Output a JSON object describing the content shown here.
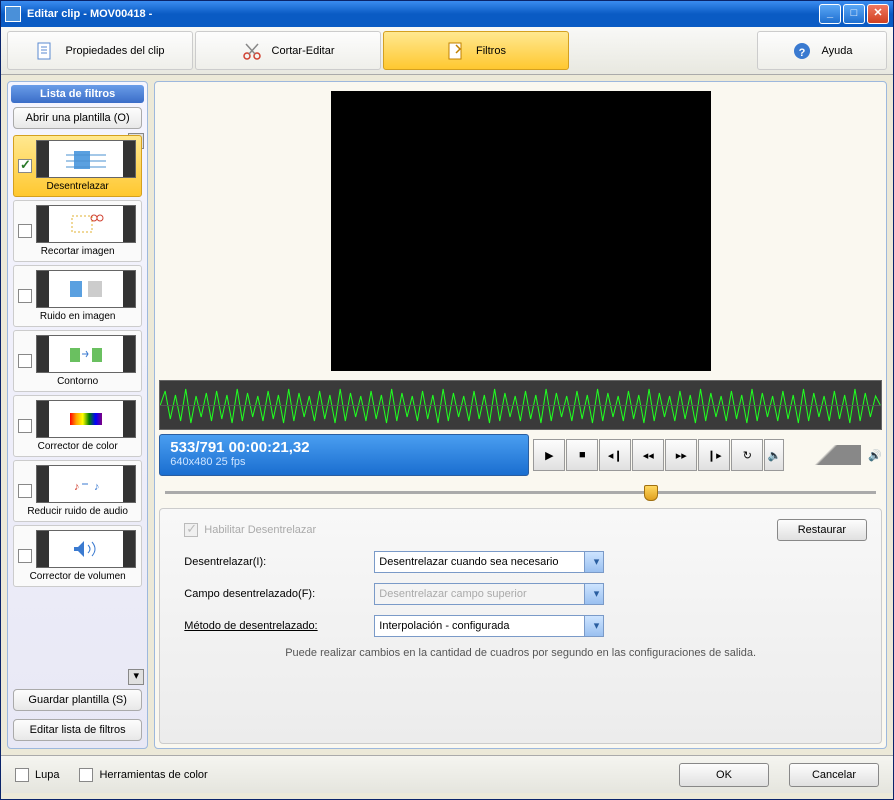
{
  "title": "Editar clip - MOV00418 -",
  "toolbar": {
    "properties": "Propiedades del clip",
    "cut_edit": "Cortar-Editar",
    "filters": "Filtros",
    "help": "Ayuda"
  },
  "sidebar": {
    "header": "Lista de filtros",
    "open_template": "Abrir una plantilla (O)",
    "save_template": "Guardar plantilla (S)",
    "edit_list": "Editar lista de filtros",
    "items": [
      {
        "label": "Desentrelazar",
        "checked": true
      },
      {
        "label": "Recortar imagen",
        "checked": false
      },
      {
        "label": "Ruido en imagen",
        "checked": false
      },
      {
        "label": "Contorno",
        "checked": false
      },
      {
        "label": "Corrector de color",
        "checked": false
      },
      {
        "label": "Reducir ruido de audio",
        "checked": false
      },
      {
        "label": "Corrector de volumen",
        "checked": false
      }
    ]
  },
  "info": {
    "main": "533/791  00:00:21,32",
    "sub": "640x480 25 fps"
  },
  "settings": {
    "enable": "Habilitar Desentrelazar",
    "restore": "Restaurar",
    "rows": [
      {
        "label": "Desentrelazar(I):",
        "value": "Desentrelazar cuando sea necesario",
        "disabled": false
      },
      {
        "label": "Campo desentrelazado(F):",
        "value": "Desentrelazar campo superior",
        "disabled": true
      },
      {
        "label": "Método de desentrelazado:",
        "value": "Interpolación - configurada",
        "disabled": false
      }
    ],
    "hint": "Puede realizar cambios en la cantidad de cuadros por segundo en las configuraciones de salida."
  },
  "footer": {
    "magnifier": "Lupa",
    "color_tools": "Herramientas de color",
    "ok": "OK",
    "cancel": "Cancelar"
  }
}
